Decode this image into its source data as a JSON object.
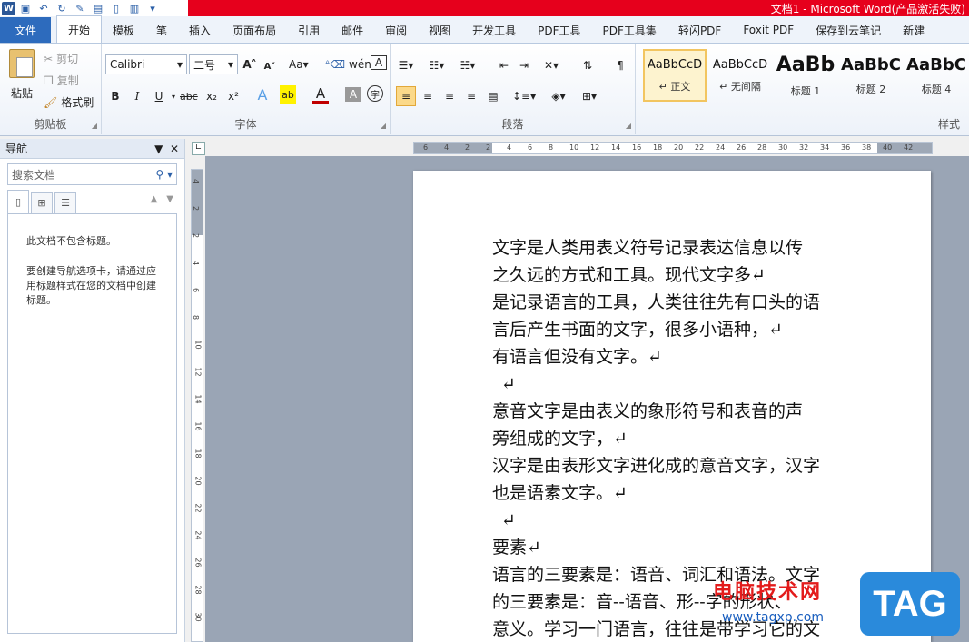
{
  "window": {
    "title": "文档1 - Microsoft Word(产品激活失败)"
  },
  "tabs": [
    "文件",
    "开始",
    "模板",
    "笔",
    "插入",
    "页面布局",
    "引用",
    "邮件",
    "审阅",
    "视图",
    "开发工具",
    "PDF工具",
    "PDF工具集",
    "轻闪PDF",
    "Foxit PDF",
    "保存到云笔记",
    "新建"
  ],
  "ribbon": {
    "clipboard": {
      "paste": "粘贴",
      "cut": "剪切",
      "copy": "复制",
      "format_painter": "格式刷",
      "label": "剪贴板"
    },
    "font": {
      "name": "Calibri",
      "size": "二号",
      "label": "字体",
      "bold": "B",
      "italic": "I",
      "underline": "U",
      "strike": "abc",
      "sub": "x₂",
      "sup": "x²",
      "grow": "A",
      "shrink": "A",
      "case": "Aa"
    },
    "paragraph": {
      "label": "段落"
    },
    "styles": {
      "label": "样式",
      "items": [
        {
          "sample": "AaBbCcD",
          "name": "↵ 正文"
        },
        {
          "sample": "AaBbCcD",
          "name": "↵ 无间隔"
        },
        {
          "sample": "AaBb",
          "name": "标题 1"
        },
        {
          "sample": "AaBbC",
          "name": "标题 2"
        },
        {
          "sample": "AaBbC",
          "name": "标题 4"
        }
      ]
    }
  },
  "nav": {
    "title": "导航",
    "search_placeholder": "搜索文档",
    "msg1": "此文档不包含标题。",
    "msg2": "要创建导航选项卡，请通过应用标题样式在您的文档中创建标题。"
  },
  "ruler": {
    "h": [
      "6",
      "4",
      "2",
      "2",
      "4",
      "6",
      "8",
      "10",
      "12",
      "14",
      "16",
      "18",
      "20",
      "22",
      "24",
      "26",
      "28",
      "30",
      "32",
      "34",
      "36",
      "38",
      "40",
      "42"
    ],
    "v": [
      "4",
      "2",
      "2",
      "4",
      "6",
      "8",
      "10",
      "12",
      "14",
      "16",
      "18",
      "20",
      "22",
      "24",
      "26",
      "28",
      "30"
    ]
  },
  "document": {
    "lines": [
      "文字是人类用表义符号记录表达信息以传",
      "之久远的方式和工具。现代文字多↵",
      "是记录语言的工具，人类往往先有口头的语",
      "言后产生书面的文字，很多小语种，↵",
      "有语言但没有文字。↵",
      "↵",
      "意音文字是由表义的象形符号和表音的声",
      "旁组成的文字，↵",
      "汉字是由表形文字进化成的意音文字，汉字",
      "也是语素文字。↵",
      "↵",
      "要素↵",
      "语言的三要素是：语音、词汇和语法。文字",
      "的三要素是：音--语音、形--字的形状、",
      "意义。学习一门语言，往往是带学习它的文"
    ]
  },
  "watermark": {
    "site": "电脑技术网",
    "url": "www.tagxp.com",
    "logo": "TAG"
  }
}
